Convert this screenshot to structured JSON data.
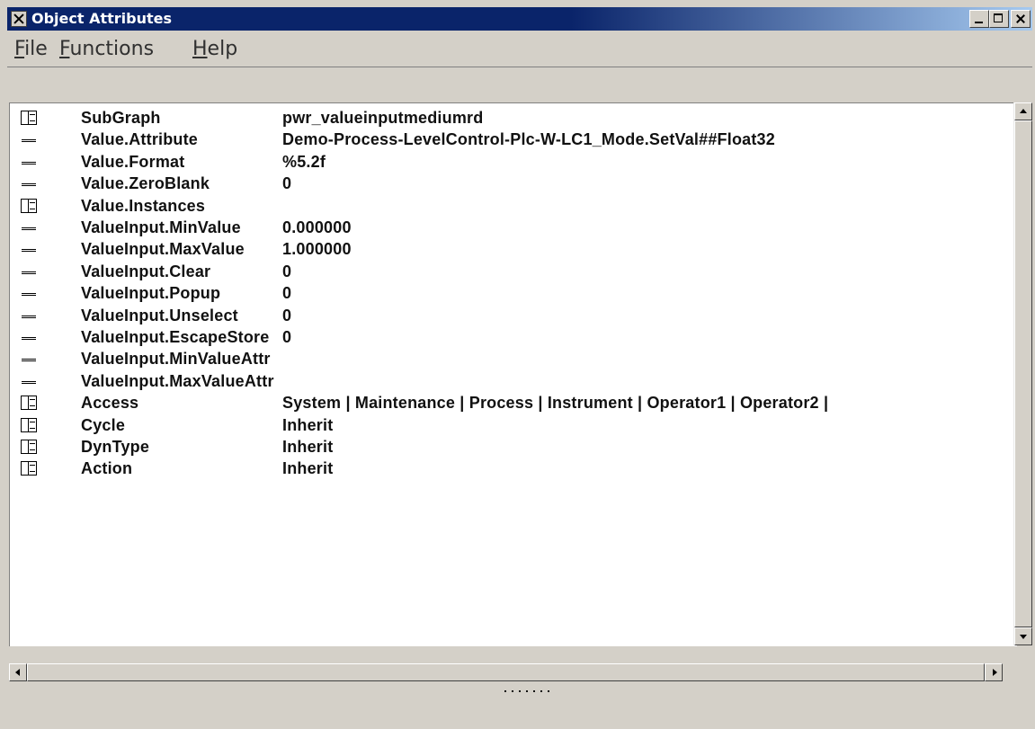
{
  "window": {
    "title": "Object Attributes",
    "icon": "x-app-icon"
  },
  "menu": [
    {
      "label": "File",
      "mnemonic": "F",
      "rest": "ile"
    },
    {
      "label": "Functions",
      "mnemonic": "F",
      "rest": "unctions"
    },
    {
      "label": "Help",
      "mnemonic": "H",
      "rest": "elp"
    }
  ],
  "attributes": [
    {
      "icon": "folder-icon",
      "name": "SubGraph",
      "value": "pwr_valueinputmediumrd"
    },
    {
      "icon": "leaf-icon",
      "name": "Value.Attribute",
      "value": "Demo-Process-LevelControl-Plc-W-LC1_Mode.SetVal##Float32"
    },
    {
      "icon": "leaf-icon",
      "name": "Value.Format",
      "value": "%5.2f"
    },
    {
      "icon": "leaf-icon",
      "name": "Value.ZeroBlank",
      "value": "0"
    },
    {
      "icon": "folder-icon",
      "name": "Value.Instances",
      "value": ""
    },
    {
      "icon": "leaf-icon",
      "name": "ValueInput.MinValue",
      "value": "0.000000"
    },
    {
      "icon": "leaf-icon",
      "name": "ValueInput.MaxValue",
      "value": "1.000000"
    },
    {
      "icon": "leaf-icon",
      "name": "ValueInput.Clear",
      "value": "0"
    },
    {
      "icon": "leaf-icon",
      "name": "ValueInput.Popup",
      "value": "0"
    },
    {
      "icon": "leaf-icon",
      "name": "ValueInput.Unselect",
      "value": "0"
    },
    {
      "icon": "leaf-icon",
      "name": "ValueInput.EscapeStore",
      "value": "0"
    },
    {
      "icon": "leaf-icon",
      "name": "ValueInput.MinValueAttr",
      "value": ""
    },
    {
      "icon": "leaf-icon",
      "name": "ValueInput.MaxValueAttr",
      "value": ""
    },
    {
      "icon": "folder-icon",
      "name": "Access",
      "value": "System | Maintenance | Process | Instrument | Operator1 | Operator2 |"
    },
    {
      "icon": "folder-icon",
      "name": "Cycle",
      "value": "Inherit"
    },
    {
      "icon": "folder-icon",
      "name": "DynType",
      "value": "Inherit"
    },
    {
      "icon": "folder-icon",
      "name": "Action",
      "value": "Inherit"
    }
  ]
}
